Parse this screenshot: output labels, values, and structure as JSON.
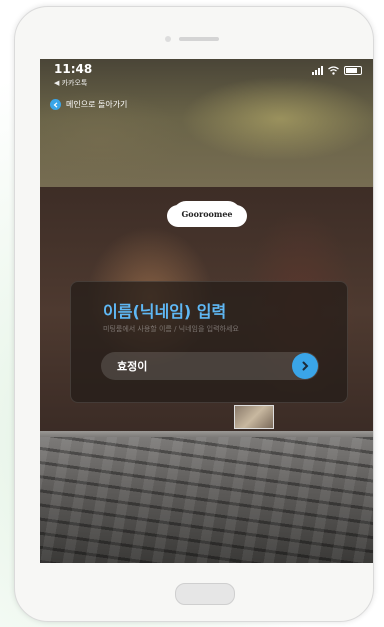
{
  "status_bar": {
    "time": "11:48",
    "carrier": "◀ 카카오톡",
    "icons": [
      "signal-icon",
      "wifi-icon",
      "battery-icon"
    ]
  },
  "nav": {
    "back_label": "메인으로 돌아가기"
  },
  "logo": {
    "text": "Gooroomee"
  },
  "card": {
    "title": "이름(닉네임) 입력",
    "subtitle": "미팅룸에서 사용할 이름 / 닉네임을 입력하세요",
    "input_value": "효정이"
  },
  "colors": {
    "accent": "#3aa5e8",
    "title": "#5fb8f5"
  }
}
